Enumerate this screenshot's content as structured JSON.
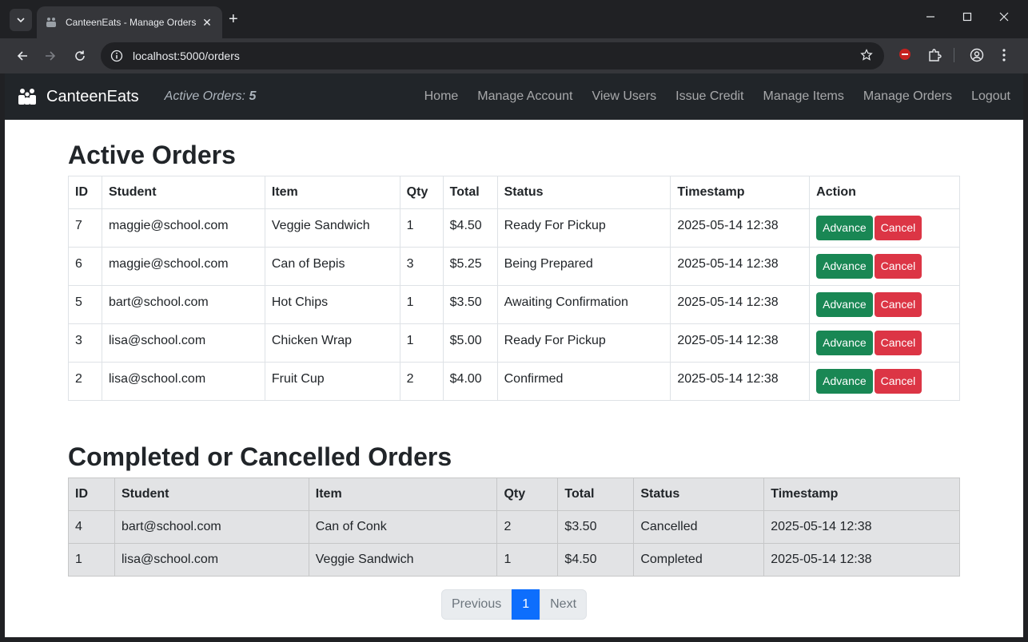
{
  "browser": {
    "tab_title": "CanteenEats - Manage Orders",
    "url": "localhost:5000/orders",
    "new_tab": "+",
    "tab_close": "✕"
  },
  "app": {
    "brand": "CanteenEats",
    "active_label": "Active Orders:",
    "active_count": "5",
    "nav": [
      "Home",
      "Manage Account",
      "View Users",
      "Issue Credit",
      "Manage Items",
      "Manage Orders",
      "Logout"
    ]
  },
  "active": {
    "title": "Active Orders",
    "columns": [
      "ID",
      "Student",
      "Item",
      "Qty",
      "Total",
      "Status",
      "Timestamp",
      "Action"
    ],
    "rows": [
      {
        "id": "7",
        "student": "maggie@school.com",
        "item": "Veggie Sandwich",
        "qty": "1",
        "total": "$4.50",
        "status": "Ready For Pickup",
        "timestamp": "2025-05-14 12:38"
      },
      {
        "id": "6",
        "student": "maggie@school.com",
        "item": "Can of Bepis",
        "qty": "3",
        "total": "$5.25",
        "status": "Being Prepared",
        "timestamp": "2025-05-14 12:38"
      },
      {
        "id": "5",
        "student": "bart@school.com",
        "item": "Hot Chips",
        "qty": "1",
        "total": "$3.50",
        "status": "Awaiting Confirmation",
        "timestamp": "2025-05-14 12:38"
      },
      {
        "id": "3",
        "student": "lisa@school.com",
        "item": "Chicken Wrap",
        "qty": "1",
        "total": "$5.00",
        "status": "Ready For Pickup",
        "timestamp": "2025-05-14 12:38"
      },
      {
        "id": "2",
        "student": "lisa@school.com",
        "item": "Fruit Cup",
        "qty": "2",
        "total": "$4.00",
        "status": "Confirmed",
        "timestamp": "2025-05-14 12:38"
      }
    ],
    "advance_label": "Advance",
    "cancel_label": "Cancel"
  },
  "done": {
    "title": "Completed or Cancelled Orders",
    "columns": [
      "ID",
      "Student",
      "Item",
      "Qty",
      "Total",
      "Status",
      "Timestamp"
    ],
    "rows": [
      {
        "id": "4",
        "student": "bart@school.com",
        "item": "Can of Conk",
        "qty": "2",
        "total": "$3.50",
        "status": "Cancelled",
        "timestamp": "2025-05-14 12:38"
      },
      {
        "id": "1",
        "student": "lisa@school.com",
        "item": "Veggie Sandwich",
        "qty": "1",
        "total": "$4.50",
        "status": "Completed",
        "timestamp": "2025-05-14 12:38"
      }
    ]
  },
  "pagination": {
    "prev": "Previous",
    "current": "1",
    "next": "Next"
  },
  "colors": {
    "navbar": "#212529",
    "advance": "#198754",
    "cancel": "#dc3545",
    "page_active": "#0d6efd"
  }
}
